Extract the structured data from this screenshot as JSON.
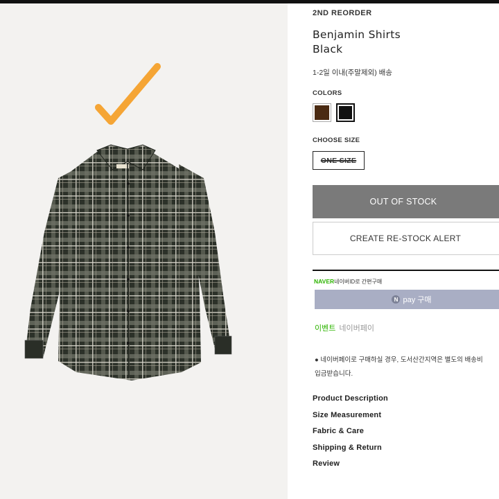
{
  "product": {
    "brand": "2ND REORDER",
    "name_line1": "Benjamin Shirts",
    "name_line2": "Black",
    "shipping_note": "1-2일 이내(주말제외) 배송"
  },
  "options": {
    "colors_label": "COLORS",
    "colors": [
      {
        "name": "brown",
        "hex": "#4a2a12"
      },
      {
        "name": "black",
        "hex": "#111111",
        "selected": true
      }
    ],
    "size_label": "CHOOSE SIZE",
    "size_option": "ONE SIZE"
  },
  "buttons": {
    "out_of_stock": "OUT OF STOCK",
    "restock_alert": "CREATE RE-STOCK ALERT"
  },
  "naver": {
    "brand": "NAVER",
    "brand_caption": "네이버ID로 간편구매",
    "pay_label": "pay 구매",
    "event_tag": "이벤트",
    "event_text": "네이버페이",
    "notice_line1": "● 네이버페이로 구매하실 경우, 도서산간지역은 별도의 배송비",
    "notice_line2": "입금받습니다."
  },
  "links": [
    "Product Description",
    "Size Measurement",
    "Fabric & Care",
    "Shipping & Return",
    "Review"
  ],
  "colors": {
    "checkmark": "#f5a535",
    "naver_green": "#2db400",
    "button_gray": "#7a7a7a",
    "naver_pay_bg": "#a9aec4"
  }
}
